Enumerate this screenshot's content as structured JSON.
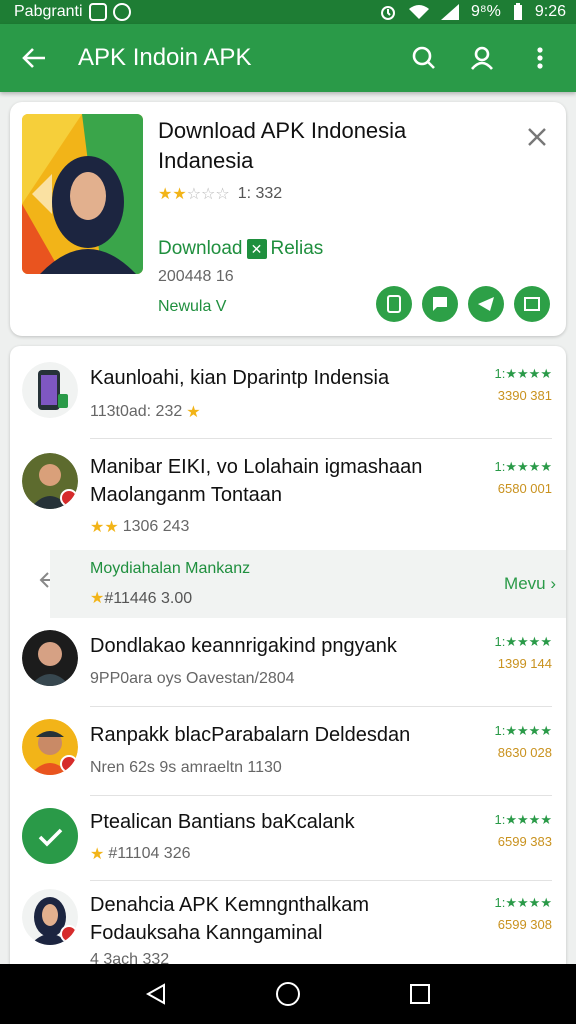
{
  "statusbar": {
    "carrier": "Pabgranti",
    "battery": "9⁸%",
    "time": "9:26"
  },
  "appbar": {
    "title": "APK Indoin APK"
  },
  "card": {
    "title": "Download APK Indonesia Indanesia",
    "rating_count": "1: 332",
    "rating_stars": 2,
    "download_label": "Download",
    "download_suffix": "Relias",
    "sub": "200448 16",
    "version": "Newula V"
  },
  "list": [
    {
      "name": "Kaunloahi, kian Dparintp Indensia",
      "meta": "113t0ad: 232",
      "stars": "1:★★★★",
      "num": "3390 381"
    },
    {
      "name": "Manibar EIKI, vo Lolahain igmashaan Maolanganm Tontaan",
      "meta": "1306 243",
      "stars": "1:★★★★",
      "num": "6580 001"
    },
    {
      "name": "Dondlakao keannrigakind pngyank",
      "meta": "9PP0ara  oys Oavestan/2804",
      "stars": "1:★★★★",
      "num": "1399 144"
    },
    {
      "name": "Ranpakk blacParabalarn Deldesdan",
      "meta": "Nren 62s  9s amraeltn 1130",
      "stars": "1:★★★★",
      "num": "8630 028"
    },
    {
      "name": "Ptealican Bantians baKcalank",
      "meta": "#11104 326",
      "stars": "1:★★★★",
      "num": "6599 383"
    },
    {
      "name": "Denahcia APK Kemngnthalkam Fodauksaha Kanngaminal",
      "meta": "4 3ach 332",
      "stars": "1:★★★★",
      "num": "6599 308"
    }
  ],
  "promo": {
    "title": "Moydiahalan Mankanz",
    "meta": "#11446 3.00",
    "more": "Mevu"
  },
  "colors": {
    "primary": "#2a9a48",
    "statusbar": "#1e7d34",
    "star": "#f2b418",
    "rank_number": "#c9921f"
  }
}
